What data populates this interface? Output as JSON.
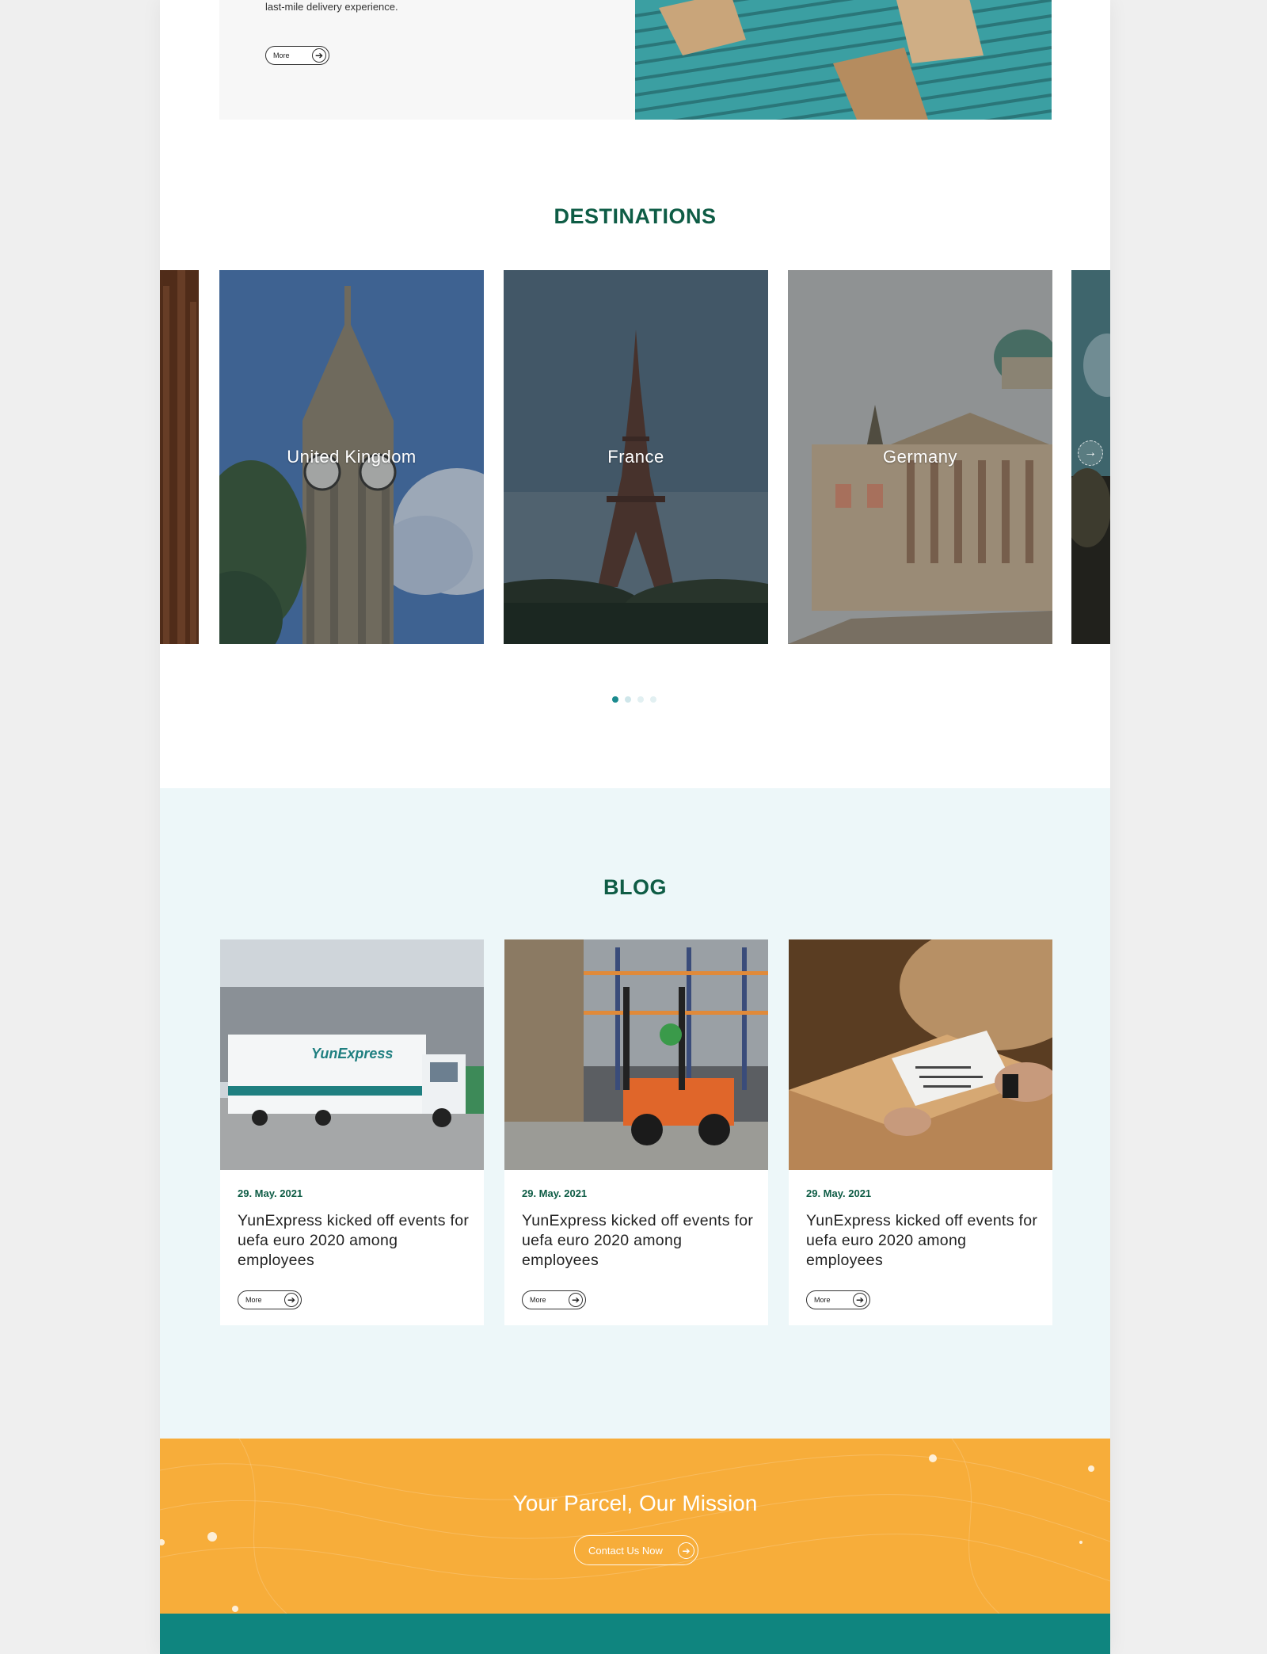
{
  "feature": {
    "description": "last-mile delivery experience.",
    "more_label": "More"
  },
  "destinations": {
    "title": "DESTINATIONS",
    "cards": [
      {
        "label": "United Kingdom"
      },
      {
        "label": "France"
      },
      {
        "label": "Germany"
      }
    ],
    "pagination": {
      "count": 4,
      "active": 1
    }
  },
  "blog": {
    "title": "BLOG",
    "posts": [
      {
        "date": "29. May. 2021",
        "title": "YunExpress kicked off events for uefa euro 2020 among employees",
        "more": "More"
      },
      {
        "date": "29. May. 2021",
        "title": "YunExpress kicked off events for uefa euro 2020 among employees",
        "more": "More"
      },
      {
        "date": "29. May. 2021",
        "title": "YunExpress kicked off events for uefa euro 2020 among employees",
        "more": "More"
      }
    ]
  },
  "cta": {
    "title": "Your Parcel, Our Mission",
    "button": "Contact Us Now"
  },
  "colors": {
    "heading_green": "#0e5c45",
    "blog_bg": "#edf7f9",
    "cta_orange": "#f7ad3a",
    "footer_teal": "#0f857f"
  }
}
